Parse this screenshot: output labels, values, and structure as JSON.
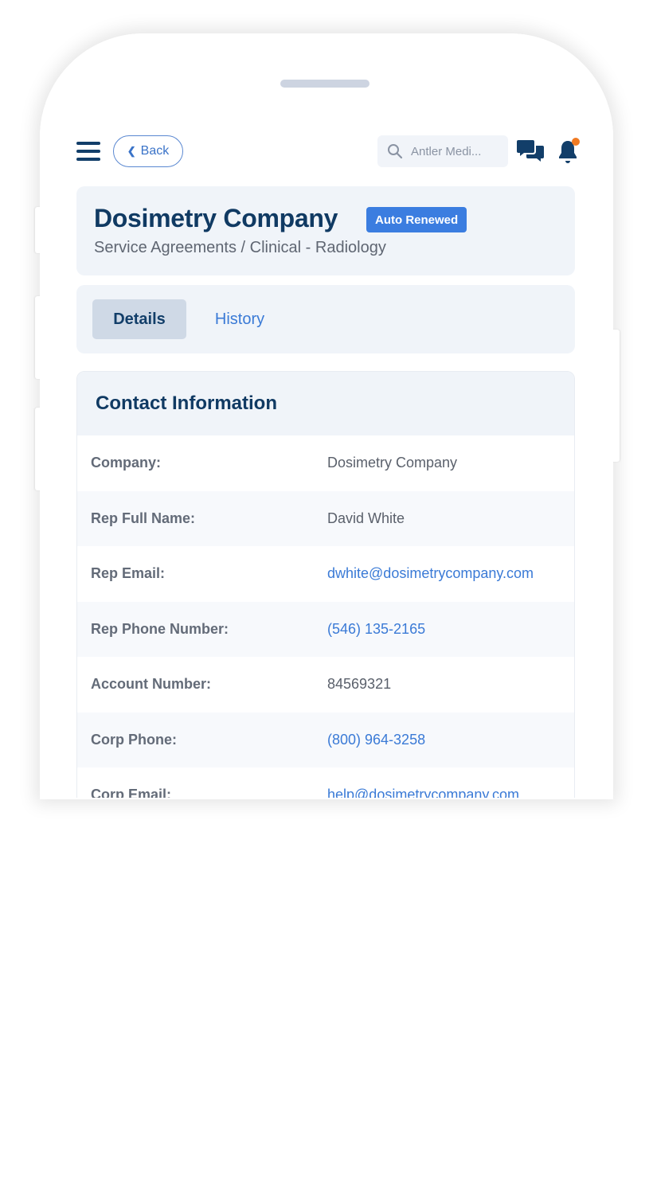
{
  "topbar": {
    "menu_icon": "hamburger-menu-icon",
    "back_label": "Back",
    "back_icon": "chevron-left-icon",
    "search_placeholder": "Antler Medi...",
    "search_icon": "search-icon",
    "chat_icon": "chat-bubbles-icon",
    "notification_icon": "bell-icon",
    "notification_dot_color": "#f07a22"
  },
  "header": {
    "title": "Dosimetry Company",
    "badge": "Auto Renewed",
    "badge_color": "#3b7de0",
    "breadcrumb": "Service Agreements / Clinical - Radiology"
  },
  "tabs": [
    {
      "label": "Details",
      "active": true
    },
    {
      "label": "History",
      "active": false
    }
  ],
  "contact": {
    "heading": "Contact Information",
    "rows": [
      {
        "label": "Company:",
        "value": "Dosimetry Company",
        "link": false
      },
      {
        "label": "Rep Full Name:",
        "value": "David White",
        "link": false
      },
      {
        "label": "Rep Email:",
        "value": "dwhite@dosimetrycompany.com",
        "link": true
      },
      {
        "label": "Rep Phone Number:",
        "value": "(546) 135-2165",
        "link": true
      },
      {
        "label": "Account Number:",
        "value": "84569321",
        "link": false
      },
      {
        "label": "Corp Phone:",
        "value": "(800) 964-3258",
        "link": true
      },
      {
        "label": "Corp Email:",
        "value": "help@dosimetrycompany.com",
        "link": true
      }
    ]
  }
}
